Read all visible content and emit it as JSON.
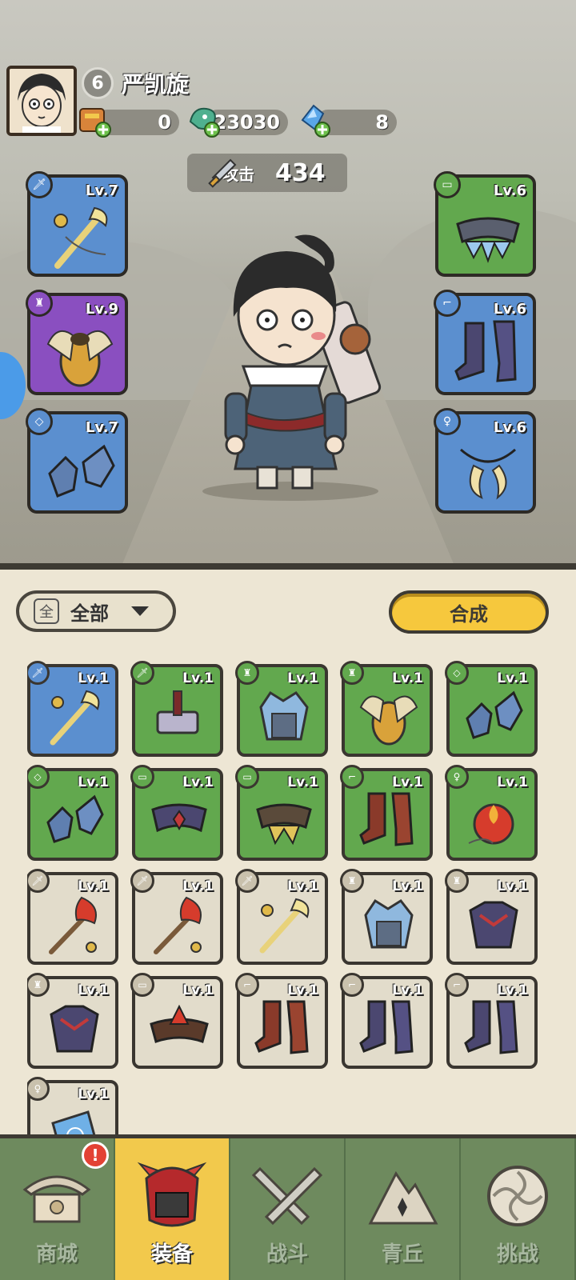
{
  "player": {
    "level": "6",
    "name": "严凯旋"
  },
  "resources": [
    {
      "icon": "scroll-coin-icon",
      "value": "0"
    },
    {
      "icon": "jade-dragon-icon",
      "value": "23030"
    },
    {
      "icon": "blue-crystal-icon",
      "value": "8"
    }
  ],
  "attack": {
    "label": "攻击",
    "value": "434"
  },
  "equipped": [
    {
      "tag": "weapon-icon",
      "color": "#5b8fcf",
      "level": "Lv.7"
    },
    {
      "tag": "armor-icon",
      "color": "#8a4fc0",
      "level": "Lv.9"
    },
    {
      "tag": "bracer-icon",
      "color": "#5b8fcf",
      "level": "Lv.7"
    },
    {
      "tag": "belt-icon",
      "color": "#62a84e",
      "level": "Lv.6"
    },
    {
      "tag": "boots-icon",
      "color": "#5b8fcf",
      "level": "Lv.6"
    },
    {
      "tag": "accessory-icon",
      "color": "#5b8fcf",
      "level": "Lv.6"
    }
  ],
  "filter": {
    "label": "全部",
    "icon_char": "全"
  },
  "merge_button": "合成",
  "inventory": [
    {
      "rarity": "blue",
      "tag": "weapon-icon",
      "level": "Lv.1",
      "art": "golden-staff"
    },
    {
      "rarity": "green",
      "tag": "weapon-icon",
      "level": "Lv.1",
      "art": "hammer"
    },
    {
      "rarity": "green",
      "tag": "armor-icon",
      "level": "Lv.1",
      "art": "ice-armor"
    },
    {
      "rarity": "green",
      "tag": "armor-icon",
      "level": "Lv.1",
      "art": "gold-armor"
    },
    {
      "rarity": "green",
      "tag": "bracer-icon",
      "level": "Lv.1",
      "art": "ice-bracer"
    },
    {
      "rarity": "green",
      "tag": "bracer-icon",
      "level": "Lv.1",
      "art": "ice-bracer"
    },
    {
      "rarity": "green",
      "tag": "belt-icon",
      "level": "Lv.1",
      "art": "dark-belt"
    },
    {
      "rarity": "green",
      "tag": "belt-icon",
      "level": "Lv.1",
      "art": "gold-belt"
    },
    {
      "rarity": "green",
      "tag": "boots-icon",
      "level": "Lv.1",
      "art": "red-boots"
    },
    {
      "rarity": "green",
      "tag": "accessory-icon",
      "level": "Lv.1",
      "art": "flame-orb"
    },
    {
      "rarity": "gray",
      "tag": "weapon-icon",
      "level": "Lv.1",
      "art": "flame-staff"
    },
    {
      "rarity": "gray",
      "tag": "weapon-icon",
      "level": "Lv.1",
      "art": "flame-staff"
    },
    {
      "rarity": "gray",
      "tag": "weapon-icon",
      "level": "Lv.1",
      "art": "golden-staff"
    },
    {
      "rarity": "gray",
      "tag": "armor-icon",
      "level": "Lv.1",
      "art": "ice-armor"
    },
    {
      "rarity": "gray",
      "tag": "armor-icon",
      "level": "Lv.1",
      "art": "dark-armor"
    },
    {
      "rarity": "gray",
      "tag": "armor-icon",
      "level": "Lv.1",
      "art": "dark-armor"
    },
    {
      "rarity": "gray",
      "tag": "belt-icon",
      "level": "Lv.1",
      "art": "flame-belt"
    },
    {
      "rarity": "gray",
      "tag": "boots-icon",
      "level": "Lv.1",
      "art": "red-boots"
    },
    {
      "rarity": "gray",
      "tag": "boots-icon",
      "level": "Lv.1",
      "art": "dark-boots"
    },
    {
      "rarity": "gray",
      "tag": "boots-icon",
      "level": "Lv.1",
      "art": "dark-boots"
    },
    {
      "rarity": "gray",
      "tag": "accessory-icon",
      "level": "Lv.1",
      "art": "blue-pouch"
    }
  ],
  "nav": [
    {
      "label": "商城",
      "icon": "shop-icon",
      "badge": "!"
    },
    {
      "label": "装备",
      "icon": "equipment-icon",
      "active": true
    },
    {
      "label": "战斗",
      "icon": "crossed-swords-icon"
    },
    {
      "label": "青丘",
      "icon": "mountain-icon"
    },
    {
      "label": "挑战",
      "icon": "challenge-orb-icon"
    }
  ],
  "colors": {
    "rarity_blue": "#5b8fcf",
    "rarity_green": "#62a84e",
    "rarity_purple": "#8a4fc0",
    "rarity_gray": "#e2dccb",
    "accent_yellow": "#f6c83d",
    "nav_green": "#6e8a5e"
  }
}
